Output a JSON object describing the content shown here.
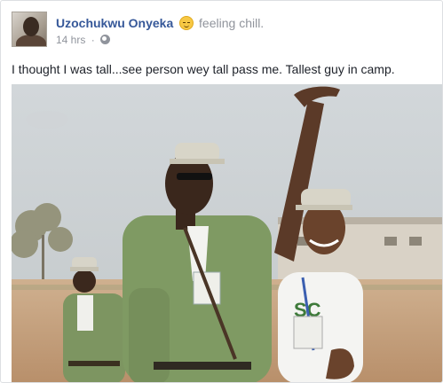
{
  "post": {
    "author_name": "Uzochukwu Onyeka",
    "feeling_text": "feeling chill.",
    "feeling_icon": "relieved-face-icon",
    "timestamp": "14 hrs",
    "separator": "·",
    "privacy_icon": "globe-icon",
    "body_text": "I thought I was tall...see person wey tall pass me. Tallest guy in camp.",
    "photo_icon_desc": "photo"
  },
  "colors": {
    "author_link": "#365899",
    "meta_gray": "#90949c",
    "text": "#1d2129",
    "uniform_green": "#7f9a63",
    "tshirt_white": "#f4f4f2",
    "sky": "#c9cfd3",
    "ground": "#c7a483"
  }
}
